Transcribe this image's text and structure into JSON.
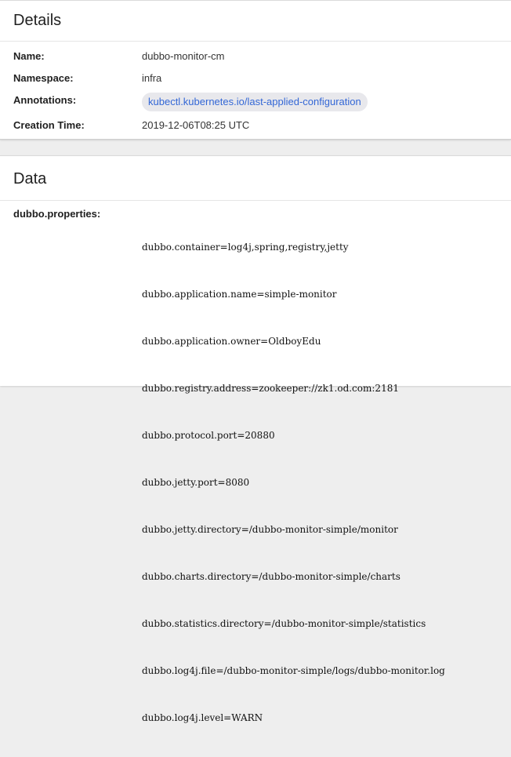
{
  "details": {
    "title": "Details",
    "name_label": "Name:",
    "name_value": "dubbo-monitor-cm",
    "namespace_label": "Namespace:",
    "namespace_value": "infra",
    "annotations_label": "Annotations:",
    "annotation_chip": "kubectl.kubernetes.io/last-applied-configuration",
    "creation_label": "Creation Time:",
    "creation_value": "2019-12-06T08:25 UTC"
  },
  "data_section": {
    "title": "Data",
    "key_label": "dubbo.properties:",
    "lines": [
      "dubbo.container=log4j,spring,registry,jetty",
      "dubbo.application.name=simple-monitor",
      "dubbo.application.owner=OldboyEdu",
      "dubbo.registry.address=zookeeper://zk1.od.com:2181",
      "dubbo.protocol.port=20880",
      "dubbo.jetty.port=8080",
      "dubbo.jetty.directory=/dubbo-monitor-simple/monitor",
      "dubbo.charts.directory=/dubbo-monitor-simple/charts",
      "dubbo.statistics.directory=/dubbo-monitor-simple/statistics",
      "dubbo.log4j.file=/dubbo-monitor-simple/logs/dubbo-monitor.log",
      "dubbo.log4j.level=WARN"
    ]
  },
  "colors": {
    "chip_background": "#e8e8ec",
    "chip_text": "#3367d6",
    "page_background": "#eeeeee"
  }
}
